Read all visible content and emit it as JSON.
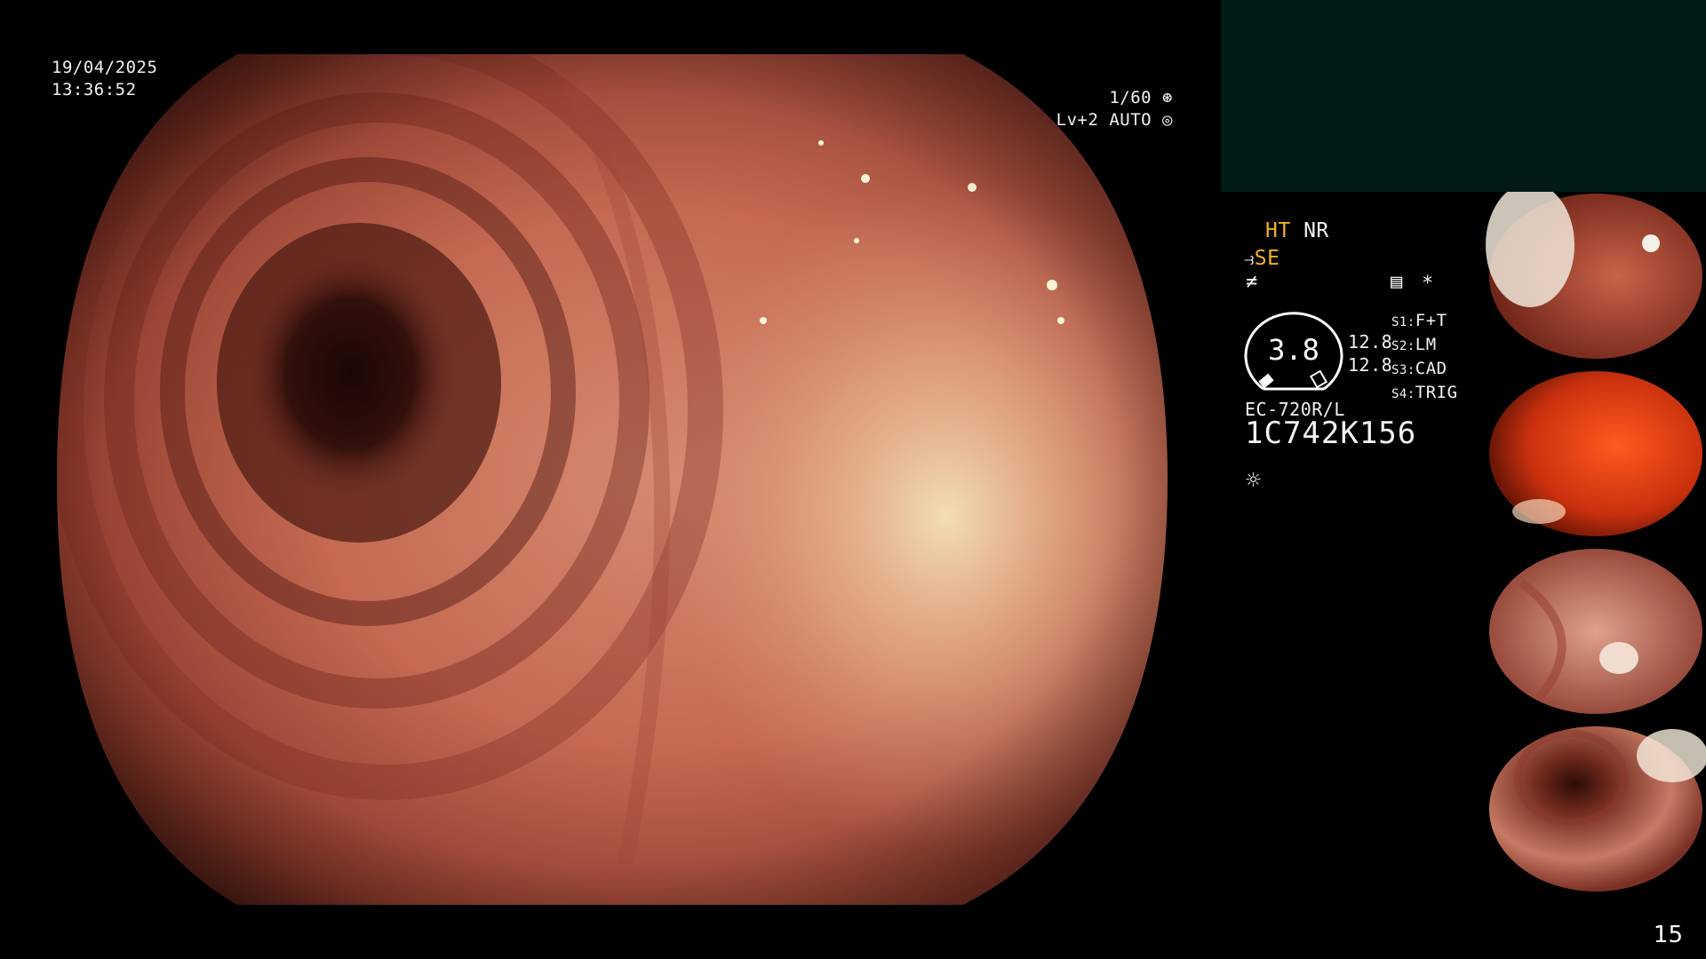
{
  "overlay": {
    "date": "19/04/2025",
    "time": "13:36:52",
    "shutter": "1/60",
    "iris": "Lv+2 AUTO"
  },
  "status": {
    "ht": "HT",
    "nr": "NR",
    "se": "SE",
    "zoom_value": "3.8",
    "value_top": "12.8",
    "value_bottom": "12.8",
    "asterisk": "*",
    "s1_key": "S1:",
    "s1_val": "F+T",
    "s2_key": "S2:",
    "s2_val": "LM",
    "s3_key": "S3:",
    "s3_val": "CAD",
    "s4_key": "S4:",
    "s4_val": "TRIG",
    "scope_model": "EC-720R/L",
    "serial": "1C742K156"
  },
  "page_number": "15",
  "icons": [
    "shutter-icon",
    "iris-icon",
    "enhance-icon",
    "color-tone-icon",
    "menu-icon",
    "light-icon"
  ],
  "colors": {
    "accent_yellow": "#f5b021",
    "panel_dark_green": "#021b17",
    "mucosa": "#c0604a"
  }
}
